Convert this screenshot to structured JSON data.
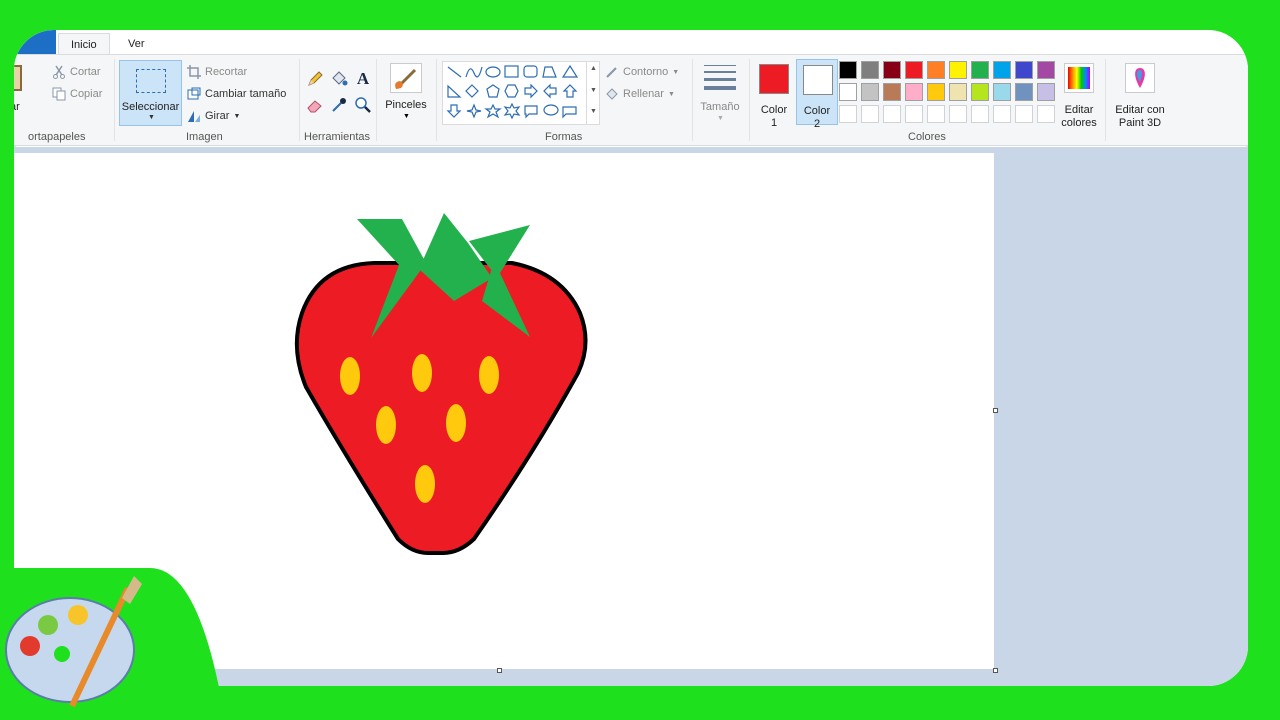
{
  "tabs": {
    "home": "Inicio",
    "view": "Ver"
  },
  "clipboard": {
    "paste": "ar",
    "cut": "Cortar",
    "copy": "Copiar",
    "group": "ortapapeles"
  },
  "image": {
    "select": "Seleccionar",
    "crop": "Recortar",
    "resize": "Cambiar tamaño",
    "rotate": "Girar",
    "group": "Imagen"
  },
  "tools": {
    "group": "Herramientas",
    "text_glyph": "A"
  },
  "brushes": {
    "label": "Pinceles"
  },
  "shapes": {
    "outline": "Contorno",
    "fill": "Rellenar",
    "group": "Formas"
  },
  "size": {
    "label": "Tamaño"
  },
  "colors": {
    "color1_label": "Color",
    "color1_num": "1",
    "color2_label": "Color",
    "color2_num": "2",
    "edit_colors_line1": "Editar",
    "edit_colors_line2": "colores",
    "paint3d_line1": "Editar con",
    "paint3d_line2": "Paint 3D",
    "group": "Colores",
    "color1": "#ed1c24",
    "color2": "#ffffff",
    "palette_row1": [
      "#000000",
      "#7f7f7f",
      "#880015",
      "#ed1c24",
      "#ff7f27",
      "#fff200",
      "#22b14c",
      "#00a2e8",
      "#3f48cc",
      "#a349a4"
    ],
    "palette_row2": [
      "#ffffff",
      "#c3c3c3",
      "#b97a57",
      "#ffaec9",
      "#ffc90e",
      "#efe4b0",
      "#b5e61d",
      "#99d9ea",
      "#7092be",
      "#c8bfe7"
    ]
  },
  "drawing": {
    "body": "#ed1c24",
    "leaves": "#22b14c",
    "seeds": "#ffc90e",
    "outline": "#000000"
  },
  "icons": [
    "scissors-icon",
    "copy-icon",
    "crop-icon",
    "resize-icon",
    "rotate-icon",
    "pencil-icon",
    "fill-bucket-icon",
    "text-icon",
    "eraser-icon",
    "color-picker-icon",
    "magnifier-icon",
    "brush-icon",
    "outline-icon",
    "fill-icon",
    "size-lines-icon",
    "rainbow-icon",
    "paint3d-icon",
    "paint-palette-logo"
  ]
}
